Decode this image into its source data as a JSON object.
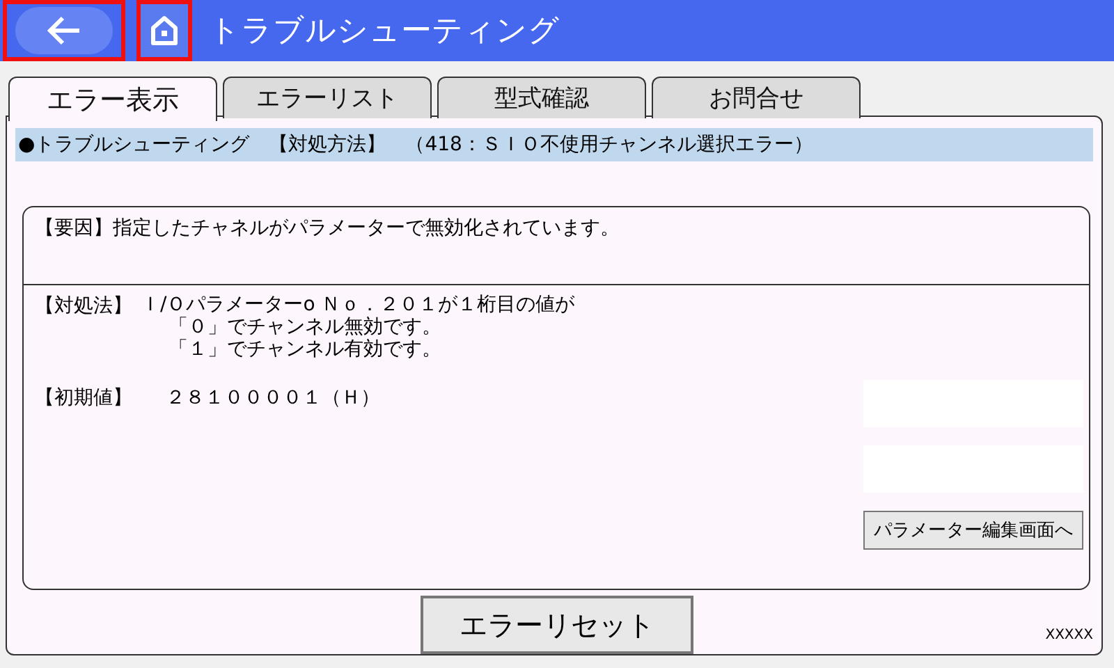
{
  "header": {
    "title": "トラブルシューティング"
  },
  "tabs": [
    {
      "label": "エラー表示",
      "selected": true
    },
    {
      "label": "エラーリスト",
      "selected": false
    },
    {
      "label": "型式確認",
      "selected": false
    },
    {
      "label": "お問合せ",
      "selected": false
    }
  ],
  "info_bar": "●トラブルシューティング　【対処方法】　（418：ＳＩＯ不使用チャンネル選択エラー）",
  "cause": {
    "label": "【要因】",
    "text": "指定したチャネルがパラメーターで無効化されています。"
  },
  "remedy": {
    "label": "【対処法】",
    "lines": [
      "Ｉ/Ｏパラメーターo Ｎｏ．２０１が１桁目の値が",
      "「０」でチャンネル無効です。",
      "「１」でチャンネル有効です。"
    ]
  },
  "initial": {
    "label": "【初期値】",
    "value": "２８１００００１（Ｈ）"
  },
  "edit_button": "パラメーター編集画面へ",
  "reset_button": "エラーリセット",
  "footer_code": "XXXXX"
}
